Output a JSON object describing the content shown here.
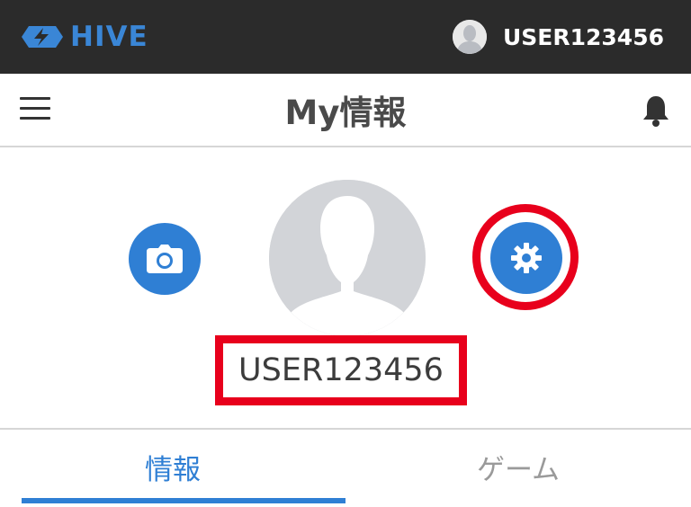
{
  "topbar": {
    "logo_text": "HIVE",
    "username": "USER123456",
    "colors": {
      "background": "#2b2b2b",
      "logo": "#3a86d6"
    }
  },
  "header": {
    "title": "My情報",
    "menu_icon": "hamburger-menu-icon",
    "notification_icon": "bell-icon"
  },
  "profile": {
    "username": "USER123456",
    "camera_icon": "camera-icon",
    "settings_icon": "gear-icon",
    "avatar_icon": "person-silhouette-icon",
    "colors": {
      "button": "#2f7fd4",
      "highlight": "#e8001c",
      "avatar_bg": "#d2d4d8"
    }
  },
  "tabs": [
    {
      "label": "情報",
      "active": true
    },
    {
      "label": "ゲーム",
      "active": false
    }
  ],
  "colors": {
    "accent": "#2f7fd4",
    "inactive_tab": "#9a9a9a"
  }
}
